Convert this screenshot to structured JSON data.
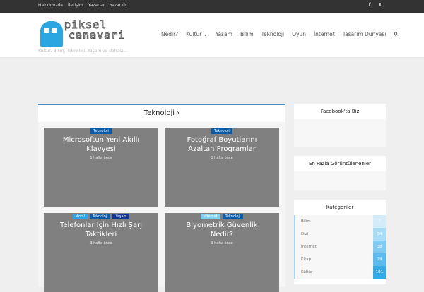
{
  "topbar": {
    "links": [
      "Hakkımızda",
      "İletişim",
      "Yazarlar",
      "Yazar Ol"
    ],
    "social": [
      "f",
      "t"
    ]
  },
  "logo": {
    "line1": "piksel",
    "line2": "canavari",
    "tagline": "Kültür, Bilim, Teknoloji, Yaşam ve dahası..."
  },
  "nav": [
    "Nedir?",
    "Kültür ⌄",
    "Yaşam",
    "Bilim",
    "Teknoloji",
    "Oyun",
    "İnternet",
    "Tasarım Dünyası"
  ],
  "search_icon": "⚲",
  "section": {
    "title": "Teknoloji ›"
  },
  "posts": [
    {
      "tags": [
        {
          "label": "Teknoloji",
          "color": "#0a5aa8"
        }
      ],
      "title": "Microsoftun Yeni Akıllı Klavyesi",
      "time": "1 hafta önce"
    },
    {
      "tags": [
        {
          "label": "Teknoloji",
          "color": "#0a5aa8"
        }
      ],
      "title": "Fotoğraf Boyutlarını Azaltan Programlar",
      "time": "1 hafta önce"
    },
    {
      "tags": [
        {
          "label": "Mobil",
          "color": "#2aa8e8"
        },
        {
          "label": "Teknoloji",
          "color": "#0a5aa8"
        },
        {
          "label": "Yaşam",
          "color": "#14349a"
        }
      ],
      "title": "Telefonlar İçin Hızlı Şarj Taktikleri",
      "time": "3 hafta önce"
    },
    {
      "tags": [
        {
          "label": "İnternet",
          "color": "#7fd0f5"
        },
        {
          "label": "Teknoloji",
          "color": "#0a5aa8"
        }
      ],
      "title": "Biyometrik Güvenlik Nedir?",
      "time": "3 hafta önce"
    }
  ],
  "sidebar": {
    "facebook": "Facebook'ta Biz",
    "popular": "En Fazla Görüntülenenler",
    "categories": {
      "title": "Kategoriler",
      "items": [
        {
          "name": "Bilim",
          "count": "7",
          "color": "#d4ecfa"
        },
        {
          "name": "Dizi",
          "count": "54",
          "color": "#a9dcf7"
        },
        {
          "name": "İnternet",
          "count": "38",
          "color": "#7fcaf2"
        },
        {
          "name": "Kitap",
          "count": "29",
          "color": "#5bbbee"
        },
        {
          "name": "Kültür",
          "count": "191",
          "color": "#34abe9"
        }
      ]
    }
  }
}
